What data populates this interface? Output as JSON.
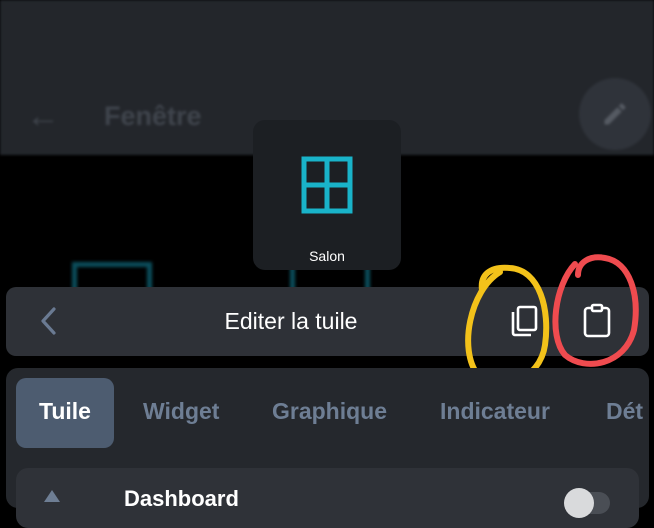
{
  "background": {
    "title": "Fenêtre",
    "back_icon": "arrow-left-icon",
    "fab_icon": "pencil-icon"
  },
  "tile_preview": {
    "label": "Salon",
    "icon": "window-icon",
    "icon_color": "#19b3c9"
  },
  "editor": {
    "title": "Editer la tuile",
    "back_icon": "chevron-left-icon",
    "copy_icon": "copy-icon",
    "paste_icon": "clipboard-icon"
  },
  "tabs": [
    {
      "label": "Tuile",
      "active": true
    },
    {
      "label": "Widget",
      "active": false
    },
    {
      "label": "Graphique",
      "active": false
    },
    {
      "label": "Indicateur",
      "active": false
    },
    {
      "label": "Dét",
      "active": false
    }
  ],
  "row": {
    "label": "Dashboard"
  },
  "colors": {
    "accent": "#19b3c9",
    "annotation_yellow": "#f3c21a",
    "annotation_red": "#ef4b4f"
  }
}
